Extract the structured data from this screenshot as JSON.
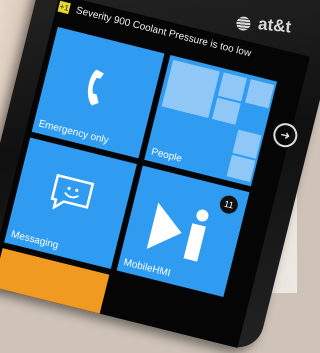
{
  "status_bar": {
    "carrier": "at&t",
    "notification_badge": "+1",
    "notification_text": "Severity 900  Coolant Pressure is  too low"
  },
  "tiles": [
    {
      "label": "Emergency only",
      "icon": "phone-handset-icon"
    },
    {
      "label": "People",
      "icon": "people-grid-icon"
    },
    {
      "label": "Messaging",
      "icon": "message-bubble-icon"
    },
    {
      "label": "MobileHMI",
      "icon": "mobilehmi-logo-icon",
      "badge": "11"
    }
  ],
  "colors": {
    "tile_blue": "#2f9cf2",
    "tile_orange": "#f19a22",
    "notification_badge": "#e8d830"
  }
}
